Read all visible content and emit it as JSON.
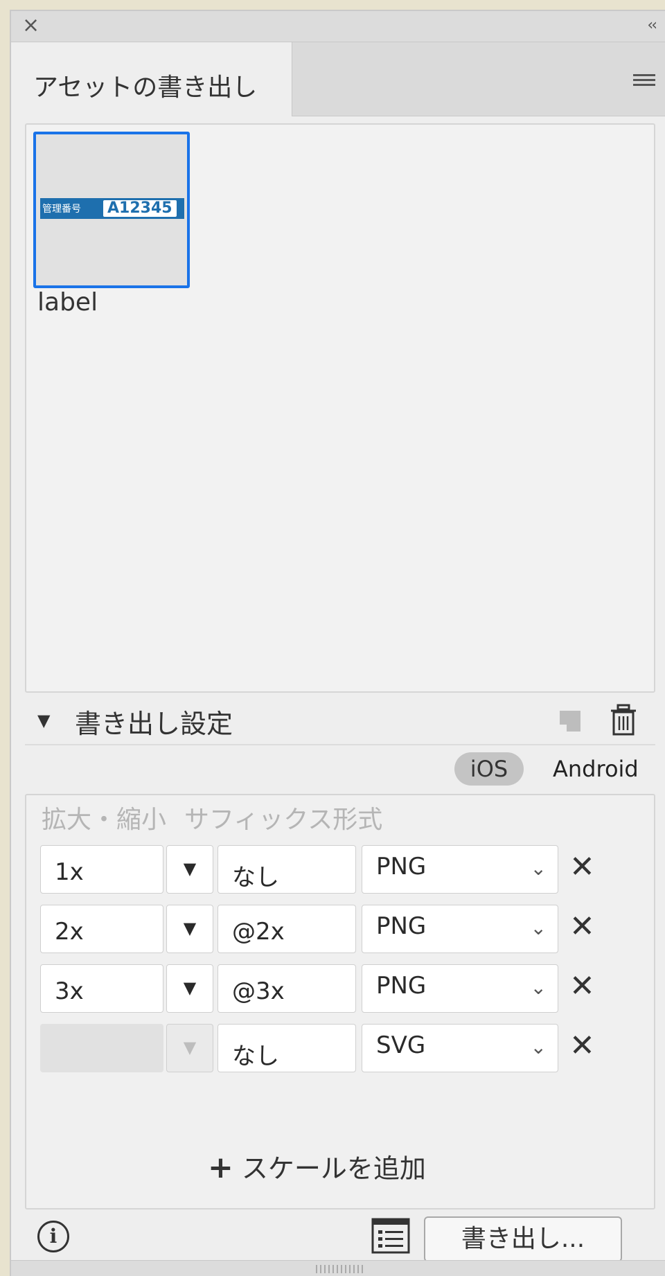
{
  "window": {
    "close_glyph": "×",
    "collapse_glyph": "‹‹"
  },
  "tab": {
    "label": "アセットの書き出し",
    "menu_icon": "hamburger-menu-icon"
  },
  "asset": {
    "name": "label",
    "preview_tag": "管理番号",
    "preview_code": "A12345"
  },
  "export_settings": {
    "title": "書き出し設定",
    "platforms": {
      "ios": "iOS",
      "android": "Android",
      "selected": "iOS"
    },
    "columns": {
      "scale": "拡大・縮小",
      "suffix": "サフィックス",
      "format": "形式"
    },
    "rows": [
      {
        "scale": "1x",
        "suffix": "なし",
        "format": "PNG"
      },
      {
        "scale": "2x",
        "suffix": "@2x",
        "format": "PNG"
      },
      {
        "scale": "3x",
        "suffix": "@3x",
        "format": "PNG"
      },
      {
        "scale": "",
        "suffix": "なし",
        "format": "SVG"
      }
    ],
    "add_scale": "スケールを追加",
    "add_glyph": "+",
    "remove_glyph": "✕",
    "chevron_glyph": "⌄",
    "dropdown_glyph": "▼"
  },
  "footer": {
    "info_glyph": "i",
    "export_button": "書き出し..."
  },
  "colors": {
    "selection": "#1a73e8",
    "preview_bg": "#1e6fae"
  }
}
